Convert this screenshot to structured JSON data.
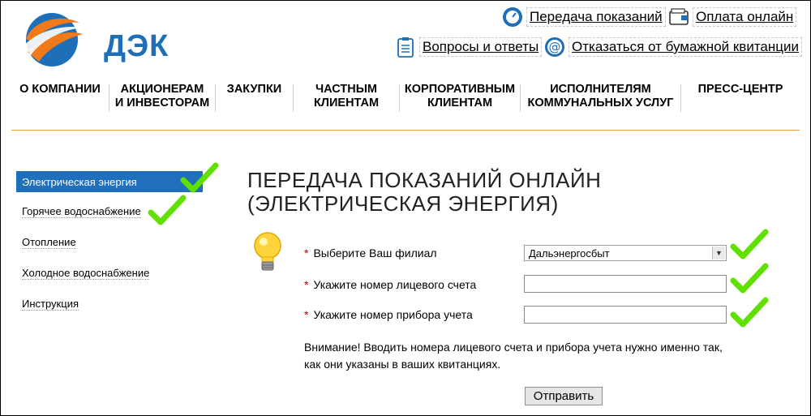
{
  "logo": {
    "text": "ДЭК"
  },
  "top_links": {
    "meter_readings": "Передача показаний",
    "pay_online": "Оплата онлайн",
    "faq": "Вопросы и ответы",
    "refuse_paper": "Отказаться от бумажной квитанции"
  },
  "nav": [
    "О компании",
    "Акционерам\nи инвесторам",
    "Закупки",
    "Частным\nклиентам",
    "Корпоративным\nклиентам",
    "Исполнителям\nкоммунальных услуг",
    "Пресс-центр"
  ],
  "sidebar": {
    "items": [
      {
        "label": "Электрическая энергия",
        "active": true
      },
      {
        "label": "Горячее водоснабжение",
        "active": false
      },
      {
        "label": "Отопление",
        "active": false
      },
      {
        "label": "Холодное водоснабжение",
        "active": false
      },
      {
        "label": "Инструкция",
        "active": false
      }
    ]
  },
  "page": {
    "title": "Передача показаний онлайн\n(электрическая энергия)"
  },
  "form": {
    "required_mark": "*",
    "branch_label": "Выберите Ваш филиал",
    "branch_value": "Дальэнергосбыт",
    "account_label": "Укажите номер лицевого счета",
    "account_value": "",
    "meter_label": "Укажите номер прибора учета",
    "meter_value": "",
    "notice": "Внимание! Вводить номера лицевого счета и прибора учета нужно именно так, как они указаны в ваших квитанциях.",
    "submit_label": "Отправить"
  },
  "colors": {
    "brand_blue": "#1e6fb7",
    "brand_orange": "#f07a1a",
    "active_bg": "#1f6fbd",
    "divider": "#f0a040",
    "check_green": "#5fe000",
    "required": "#c00000"
  }
}
